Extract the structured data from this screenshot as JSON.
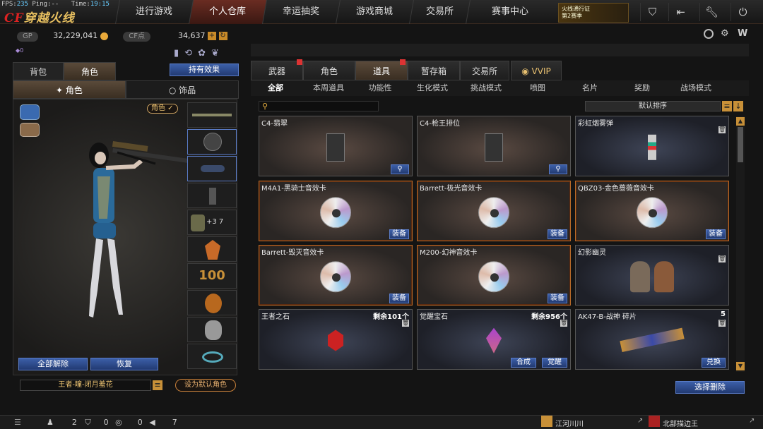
{
  "status": {
    "fps_label": "FPS:",
    "fps_value": "235",
    "ping_label": "Ping:",
    "ping_value": "--",
    "time_label": "Time:",
    "time_value": "19:15"
  },
  "logo": {
    "text_prefix": "CF",
    "text_rest": "穿越火线"
  },
  "nav": [
    {
      "label": "进行游戏"
    },
    {
      "label": "个人仓库"
    },
    {
      "label": "幸运抽奖"
    },
    {
      "label": "游戏商城"
    },
    {
      "label": "交易所"
    },
    {
      "label": "赛事中心"
    }
  ],
  "promo": {
    "line1": "火线通行证",
    "line2": "第2赛季"
  },
  "top_icons": [
    "shield-icon",
    "exit-icon",
    "wrench-icon",
    "power-icon"
  ],
  "currency": {
    "gp_label": "GP",
    "gp_value": "32,229,041",
    "cf_label": "CF点",
    "cf_value": "34,637",
    "extra": "0"
  },
  "left_tabs": {
    "bag": "背包",
    "role": "角色",
    "hold_effect": "持有效果"
  },
  "sub_tabs": {
    "role": "角色",
    "accessory": "饰品"
  },
  "role_badge": "角色 ✓",
  "left_buttons": {
    "remove_all": "全部解除",
    "restore": "恢复",
    "set_default": "设为默认角色"
  },
  "role_name": "王者-瞳-闭月羞花",
  "right_tabs": [
    {
      "label": "武器"
    },
    {
      "label": "角色"
    },
    {
      "label": "道具"
    },
    {
      "label": "暂存箱"
    },
    {
      "label": "交易所"
    },
    {
      "label": "VVIP"
    }
  ],
  "filter_tabs": [
    "全部",
    "本周道具",
    "功能性",
    "生化模式",
    "挑战模式",
    "喷图",
    "名片",
    "奖励",
    "战场模式"
  ],
  "sort_label": "默认排序",
  "items": [
    {
      "title": "C4-翡翠",
      "button": "search"
    },
    {
      "title": "C4-枪王排位",
      "button": "search"
    },
    {
      "title": "彩虹烟雾弹"
    },
    {
      "title": "M4A1-黑骑士音效卡",
      "button": "装备"
    },
    {
      "title": "Barrett-极光音效卡",
      "button": "装备"
    },
    {
      "title": "QBZ03-金色蔷薇音效卡",
      "button": "装备"
    },
    {
      "title": "Barrett-毁灭音效卡",
      "button": "装备"
    },
    {
      "title": "M200-幻神音效卡",
      "button": "装备"
    },
    {
      "title": "幻影幽灵"
    },
    {
      "title": "王者之石",
      "count": "剩余101个"
    },
    {
      "title": "觉醒宝石",
      "count": "剩余956个",
      "btn_a": "合成",
      "btn_b": "觉醒"
    },
    {
      "title": "AK47-B-战神 碎片",
      "count": "5",
      "button": "兑换"
    }
  ],
  "select_delete": "选择删除",
  "bottom": {
    "count1": "2",
    "count2": "0",
    "count3": "0",
    "count4": "7",
    "player1": "江河川川",
    "player2": "北部描边王"
  },
  "colors": {
    "accent_blue": "#3c5fa8",
    "gold_border": "#b86a28",
    "nav_active": "#6a2c22"
  }
}
